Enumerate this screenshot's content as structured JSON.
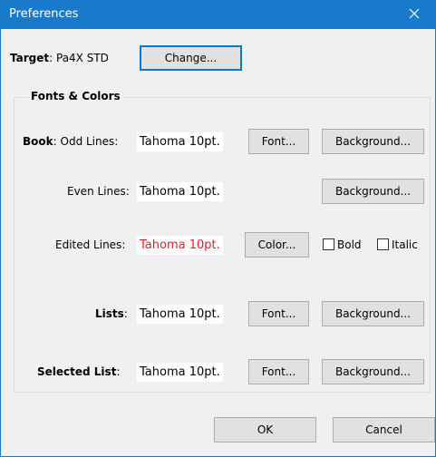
{
  "window": {
    "title": "Preferences"
  },
  "target": {
    "label": "Target",
    "colon": ":",
    "value": "Pa4X STD",
    "change_label": "Change..."
  },
  "group": {
    "title": "Fonts & Colors"
  },
  "rows": {
    "book": {
      "label": "Book",
      "colon": ":",
      "sublabel": "Odd Lines:",
      "sample": "Tahoma 10pt.",
      "font_label": "Font...",
      "background_label": "Background..."
    },
    "even": {
      "sublabel": "Even Lines:",
      "sample": "Tahoma 10pt.",
      "background_label": "Background..."
    },
    "edited": {
      "sublabel": "Edited Lines:",
      "sample": "Tahoma 10pt.",
      "sample_color": "#e8192c",
      "color_label": "Color...",
      "bold_label": "Bold",
      "italic_label": "Italic",
      "bold_checked": false,
      "italic_checked": false
    },
    "lists": {
      "label": "Lists",
      "colon": ":",
      "sample": "Tahoma 10pt.",
      "font_label": "Font...",
      "background_label": "Background..."
    },
    "selected": {
      "label": "Selected List",
      "colon": ":",
      "sample": "Tahoma 10pt.",
      "font_label": "Font...",
      "background_label": "Background..."
    }
  },
  "footer": {
    "ok_label": "OK",
    "cancel_label": "Cancel"
  },
  "colors": {
    "titlebar": "#1979ca",
    "focus_border": "#0078d7",
    "edited_text": "#e8192c"
  },
  "icons": {
    "close": "close-icon"
  }
}
